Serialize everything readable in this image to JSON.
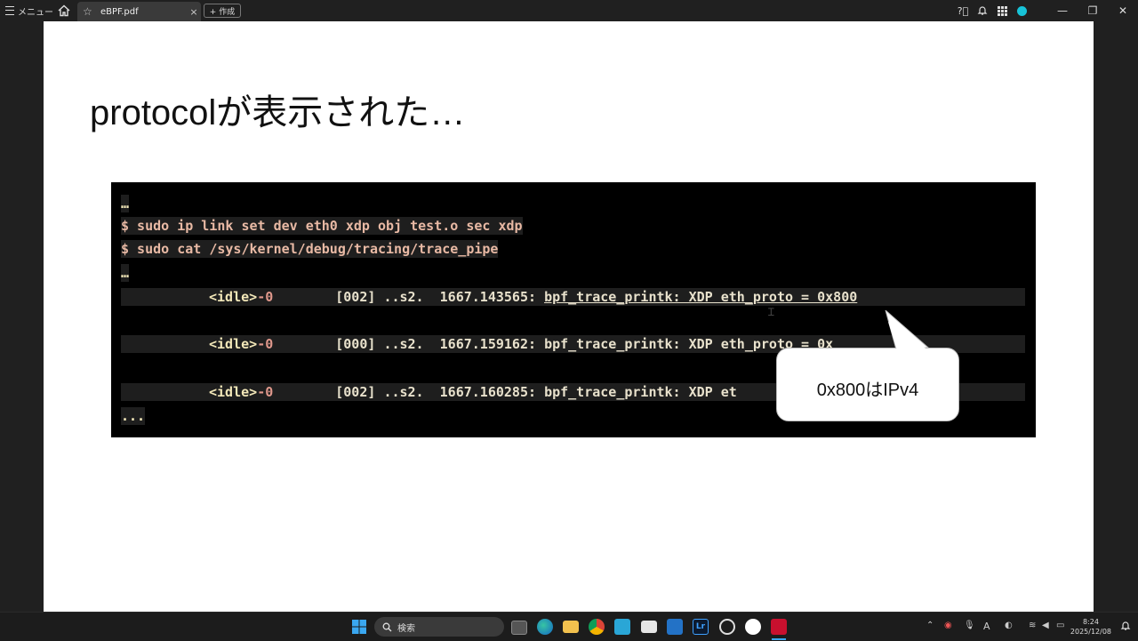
{
  "topbar": {
    "menu_label": "メニュー",
    "tab_title": "eBPF.pdf",
    "tab_close": "×",
    "new_tab_label": "+ 作成",
    "minimize": "—",
    "restore": "❐",
    "close": "✕"
  },
  "slide": {
    "title": "protocolが表示された…",
    "terminal": {
      "lines": [
        "…",
        "$ sudo ip link set dev eth0 xdp obj test.o sec xdp",
        "$ sudo cat /sys/kernel/debug/tracing/trace_pipe",
        "…"
      ],
      "trace": [
        {
          "proc": "<idle>",
          "pid": "-0",
          "cpu": "[002]",
          "flags": "..s2.",
          "time": "1667.143565:",
          "msg": "bpf_trace_printk: XDP eth_proto = 0x800"
        },
        {
          "proc": "<idle>",
          "pid": "-0",
          "cpu": "[000]",
          "flags": "..s2.",
          "time": "1667.159162:",
          "msg": "bpf_trace_printk: XDP eth_proto = 0x"
        },
        {
          "proc": "<idle>",
          "pid": "-0",
          "cpu": "[002]",
          "flags": "..s2.",
          "time": "1667.160285:",
          "msg": "bpf_trace_printk: XDP et"
        }
      ],
      "ellipsis": "..."
    },
    "callout": "0x800はIPv4"
  },
  "taskbar": {
    "search_label": "検索",
    "time": "8:24",
    "date": "2025/12/08",
    "font_indicator": "A"
  },
  "colors": {
    "accent": "#17c3d8",
    "prompt": "#e8b9a4",
    "idle": "#f2e7b8"
  }
}
